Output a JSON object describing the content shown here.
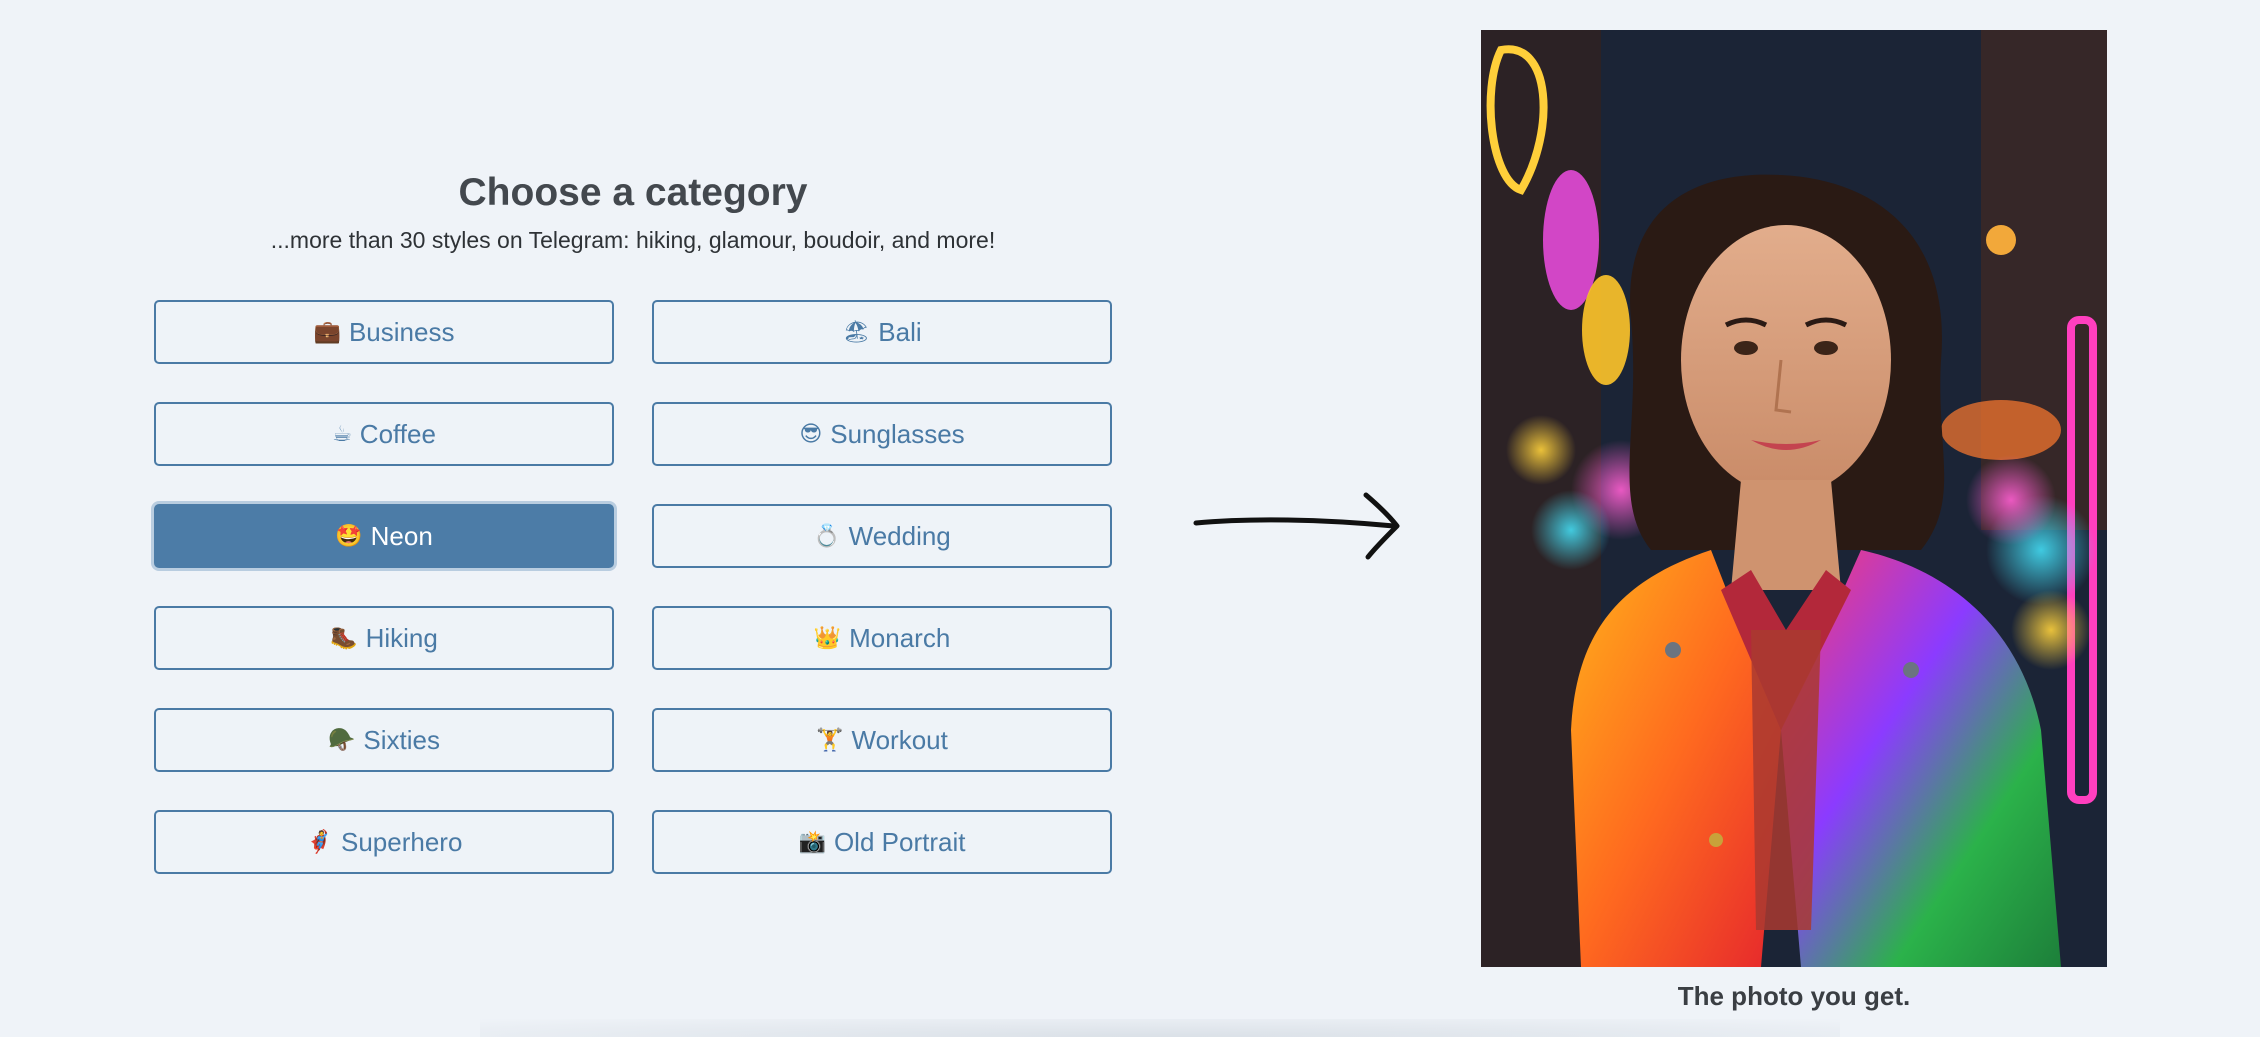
{
  "header": {
    "title": "Choose a category",
    "subtitle": "...more than 30 styles on Telegram: hiking, glamour, boudoir, and more!"
  },
  "categories": [
    {
      "emoji": "💼",
      "label": "Business",
      "active": false
    },
    {
      "emoji": "🏖",
      "label": "Bali",
      "active": false
    },
    {
      "emoji": "☕",
      "label": "Coffee",
      "active": false
    },
    {
      "emoji": "😎",
      "label": "Sunglasses",
      "active": false
    },
    {
      "emoji": "🤩",
      "label": "Neon",
      "active": true
    },
    {
      "emoji": "💍",
      "label": "Wedding",
      "active": false
    },
    {
      "emoji": "🥾",
      "label": "Hiking",
      "active": false
    },
    {
      "emoji": "👑",
      "label": "Monarch",
      "active": false
    },
    {
      "emoji": "🪖",
      "label": "Sixties",
      "active": false
    },
    {
      "emoji": "🏋",
      "label": "Workout",
      "active": false
    },
    {
      "emoji": "🦸",
      "label": "Superhero",
      "active": false
    },
    {
      "emoji": "📸",
      "label": "Old Portrait",
      "active": false
    }
  ],
  "preview": {
    "caption": "The photo you get."
  },
  "colors": {
    "background": "#eff3f8",
    "accent": "#4c7ca7",
    "button_border": "#4a7aa5"
  },
  "icons": {
    "arrow": "arrow-right-icon"
  }
}
